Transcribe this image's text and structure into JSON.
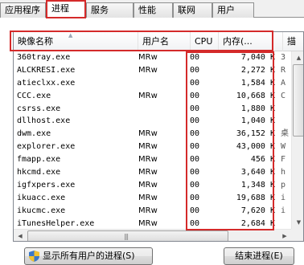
{
  "tabs": [
    {
      "label": "应用程序",
      "active": false
    },
    {
      "label": "进程",
      "active": true
    },
    {
      "label": "服务",
      "active": false
    },
    {
      "label": "性能",
      "active": false
    },
    {
      "label": "联网",
      "active": false
    },
    {
      "label": "用户",
      "active": false
    }
  ],
  "columns": {
    "name": "映像名称",
    "user": "用户名",
    "cpu": "CPU",
    "mem": "内存(...",
    "desc": "描"
  },
  "processes": [
    {
      "name": "360tray.exe",
      "user": "MRw",
      "cpu": "00",
      "mem": "7,040 K",
      "desc": "3"
    },
    {
      "name": "ALCKRESI.exe",
      "user": "MRw",
      "cpu": "00",
      "mem": "2,272 K",
      "desc": "R"
    },
    {
      "name": "atieclxx.exe",
      "user": "",
      "cpu": "00",
      "mem": "1,584 K",
      "desc": "A"
    },
    {
      "name": "CCC.exe",
      "user": "MRw",
      "cpu": "00",
      "mem": "10,668 K",
      "desc": "C"
    },
    {
      "name": "csrss.exe",
      "user": "",
      "cpu": "00",
      "mem": "1,880 K",
      "desc": ""
    },
    {
      "name": "dllhost.exe",
      "user": "",
      "cpu": "00",
      "mem": "1,040 K",
      "desc": ""
    },
    {
      "name": "dwm.exe",
      "user": "MRw",
      "cpu": "00",
      "mem": "36,152 K",
      "desc": "桌"
    },
    {
      "name": "explorer.exe",
      "user": "MRw",
      "cpu": "00",
      "mem": "43,000 K",
      "desc": "W"
    },
    {
      "name": "fmapp.exe",
      "user": "MRw",
      "cpu": "00",
      "mem": "456 K",
      "desc": "F"
    },
    {
      "name": "hkcmd.exe",
      "user": "MRw",
      "cpu": "00",
      "mem": "3,640 K",
      "desc": "h"
    },
    {
      "name": "igfxpers.exe",
      "user": "MRw",
      "cpu": "00",
      "mem": "1,348 K",
      "desc": "p"
    },
    {
      "name": "ikuacc.exe",
      "user": "MRw",
      "cpu": "00",
      "mem": "19,688 K",
      "desc": "i"
    },
    {
      "name": "ikucmc.exe",
      "user": "MRw",
      "cpu": "00",
      "mem": "7,620 K",
      "desc": "i"
    },
    {
      "name": "iTunesHelper.exe",
      "user": "MRw",
      "cpu": "00",
      "mem": "2,684 K",
      "desc": ""
    }
  ],
  "buttons": {
    "show_all": "显示所有用户的进程(S)",
    "end_process": "结束进程(E)"
  },
  "icons": {
    "shield": "shield-icon",
    "sort": "sort-up-icon"
  },
  "colors": {
    "highlight": "#d42a2a"
  }
}
